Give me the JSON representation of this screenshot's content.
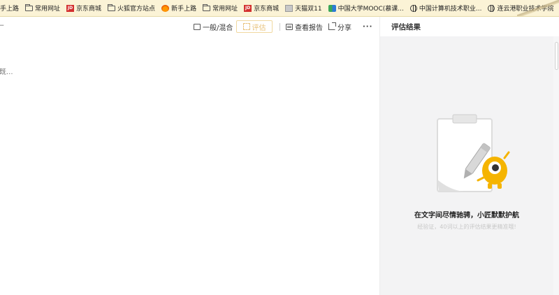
{
  "bookmarks": [
    {
      "label": "手上路",
      "icon": "none"
    },
    {
      "label": "常用网址",
      "icon": "folder-icon"
    },
    {
      "label": "京东商城",
      "icon": "jd-icon"
    },
    {
      "label": "火狐官方站点",
      "icon": "folder-icon"
    },
    {
      "label": "新手上路",
      "icon": "firefox-icon"
    },
    {
      "label": "常用网址",
      "icon": "folder-icon"
    },
    {
      "label": "京东商城",
      "icon": "jd-icon"
    },
    {
      "label": "天猫双11",
      "icon": "tmall-icon"
    },
    {
      "label": "中国大学MOOC(慕课...",
      "icon": "mooc-icon"
    },
    {
      "label": "中国计算机技术职业...",
      "icon": "globe-icon"
    },
    {
      "label": "连云港职业技术学院",
      "icon": "globe-icon"
    }
  ],
  "toolbar": {
    "left_glyph": "⌐",
    "mode_label": "一般/混合",
    "evaluate_label": "评估",
    "report_label": "查看报告",
    "share_label": "分享",
    "more_label": "···"
  },
  "editor": {
    "placeholder": "既..."
  },
  "panel": {
    "title": "评估结果",
    "empty_title": "在文字间尽情驰骋，小匠默默护航",
    "empty_subtitle": "经验证，40词以上的评估结果更精准哦!"
  },
  "colors": {
    "bookmark_bg": "#fbf3d6",
    "accent_yellow": "#f5b400",
    "panel_bg": "#f3f3f4"
  }
}
